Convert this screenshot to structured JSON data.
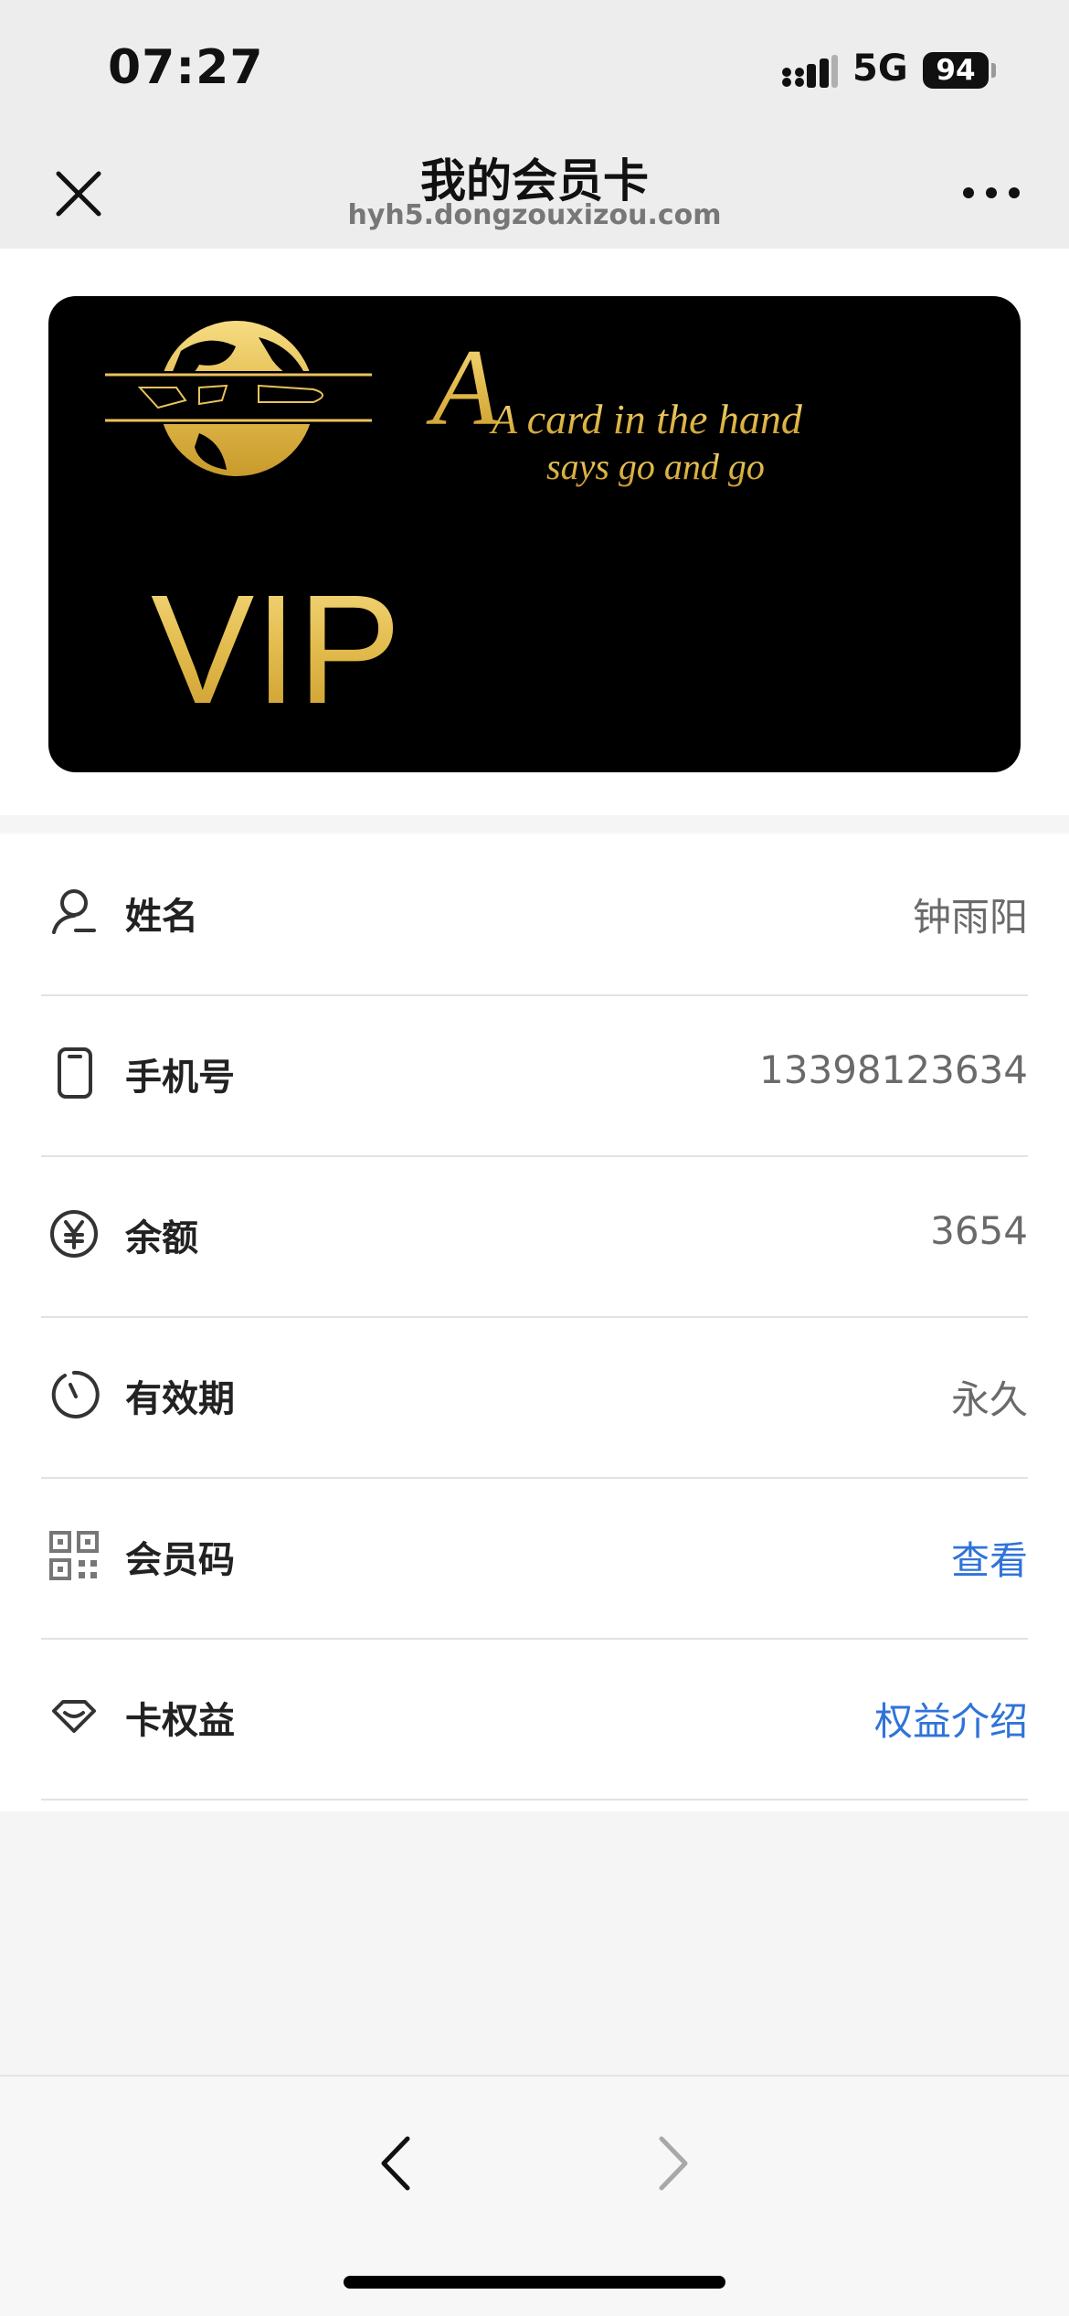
{
  "status": {
    "time": "07:27",
    "network": "5G",
    "battery": "94"
  },
  "nav": {
    "title": "我的会员卡",
    "url": "hyh5.dongzouxizou.com"
  },
  "card": {
    "tagline_line1": "A card in the hand",
    "tagline_line2": "says go and go",
    "vip_text": "VIP",
    "accent_color": "#e8c25a"
  },
  "rows": [
    {
      "icon": "person-icon",
      "label": "姓名",
      "value": "钟雨阳"
    },
    {
      "icon": "phone-icon",
      "label": "手机号",
      "value": "13398123634"
    },
    {
      "icon": "yen-icon",
      "label": "余额",
      "value": "3654"
    },
    {
      "icon": "clock-icon",
      "label": "有效期",
      "value": "永久"
    },
    {
      "icon": "qrcode-icon",
      "label": "会员码",
      "value": "查看"
    },
    {
      "icon": "heart-badge-icon",
      "label": "卡权益",
      "value": "权益介绍"
    }
  ],
  "colors": {
    "link": "#2f73d9",
    "label": "#222222",
    "value": "#6a6a6a"
  }
}
